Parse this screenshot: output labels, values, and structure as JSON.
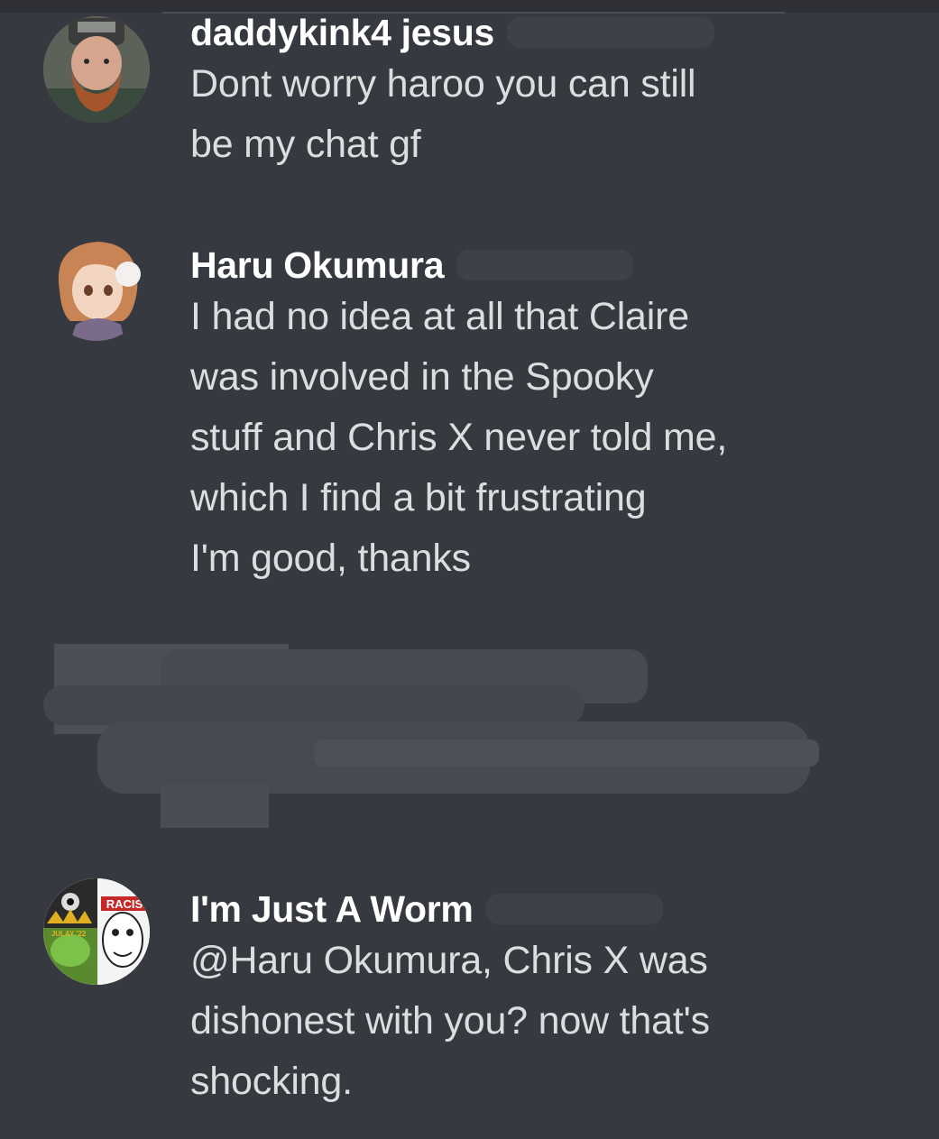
{
  "messages": [
    {
      "author": "daddykink4 jesus",
      "avatar_icon": "bearded-man-avatar-icon",
      "lines": [
        "Dont worry haroo you can still",
        "be my chat gf"
      ]
    },
    {
      "author": "Haru Okumura",
      "avatar_icon": "anime-girl-avatar-icon",
      "lines": [
        "I had no idea at all that Claire",
        "was involved in the Spooky",
        "stuff and Chris X never told me,",
        "which I find a bit frustrating",
        "I'm good, thanks"
      ]
    },
    {
      "author": "I'm Just A Worm",
      "avatar_icon": "meme-collage-avatar-icon",
      "avatar_text": [
        "RACIS",
        "JULAY '22"
      ],
      "lines": [
        "@Haru Okumura, Chris X was",
        "dishonest with you? now that's",
        "shocking."
      ]
    }
  ],
  "colors": {
    "background": "#36393f",
    "username": "#ffffff",
    "message_text": "#dcddde",
    "redaction": "#474a51"
  }
}
